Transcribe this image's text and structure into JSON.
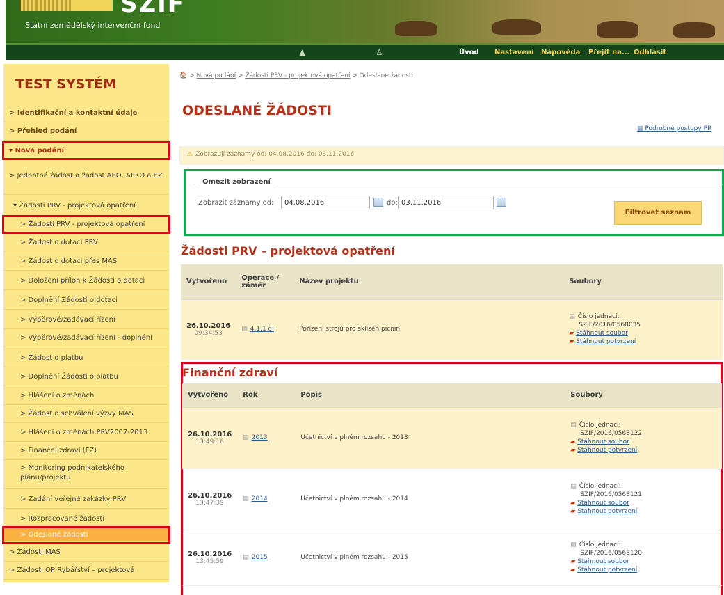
{
  "header": {
    "logo_text": "SZIF",
    "org_name": "Státní zemědělský intervenční fond",
    "nav": [
      "Úvod",
      "Nastavení",
      "Nápověda",
      "Přejít na...",
      "Odhlásit"
    ]
  },
  "sidebar": {
    "title": "TEST SYSTÉM",
    "items": [
      "> Identifikační a kontaktní údaje",
      "> Přehled podání",
      "▾ Nová podání",
      "> Jednotná žádost a žádost AEO, AEKO a EZ",
      "▾ Žádosti PRV - projektová opatření",
      "> Žádosti PRV - projektová opatření",
      "> Žádost o dotaci PRV",
      "> Žádost o dotaci přes MAS",
      "> Doložení příloh k Žádosti o dotaci",
      "> Doplnění Žádosti o dotaci",
      "> Výběrové/zadávací řízení",
      "> Výběrové/zadávací řízení - doplnění",
      "> Žádost o platbu",
      "> Doplnění Žádosti o platbu",
      "> Hlášení o změnách",
      "> Žádost o schválení výzvy MAS",
      "> Hlášení o změnách PRV2007-2013",
      "> Finanční zdraví (FZ)",
      "> Monitoring podnikatelského plánu/projektu",
      "> Zadání veřejné zakázky PRV",
      "> Rozpracované žádosti",
      "> Odeslané žádosti",
      "> Žádosti MAS",
      "> Žádosti OP Rybářství – projektová"
    ]
  },
  "main": {
    "breadcrumb": {
      "home": "🏠",
      "sep1": " > ",
      "b1": "Nová podání",
      "sep2": " > ",
      "b2": "Žádosti PRV - projektová opatření",
      "sep3": " > ",
      "b3": "Odeslané žádosti"
    },
    "title": "ODESLANÉ ŽÁDOSTI",
    "details_link": "Podrobné postupy PR",
    "notice": "Zobrazují záznamy od: 04.08.2016 do: 03.11.2016",
    "filter": {
      "legend": "Omezit zobrazení",
      "from_label": "Zobrazit záznamy od:",
      "from_value": "04.08.2016",
      "to_label": "do:",
      "to_value": "03.11.2016",
      "button": "Filtrovat seznam"
    },
    "prv": {
      "title": "Žádosti PRV – projektová opatření",
      "headers": [
        "Vytvořeno",
        "Operace / záměr",
        "Název projektu",
        "Soubory"
      ],
      "rows": [
        {
          "date": "26.10.2016",
          "time": "09:34:53",
          "op": "4.1.1 c)",
          "name": "Pořízení strojů pro sklizeň pícnin",
          "doc_label": "Číslo jednací:",
          "doc_no": "SZIF/2016/0568035",
          "f1": "Stáhnout soubor",
          "f2": "Stáhnout potvrzení"
        }
      ]
    },
    "fz": {
      "title": "Finanční zdraví",
      "headers": [
        "Vytvořeno",
        "Rok",
        "Popis",
        "Soubory"
      ],
      "rows": [
        {
          "date": "26.10.2016",
          "time": "13:49:16",
          "year": "2013",
          "desc": "Účetnictví v plném rozsahu - 2013",
          "doc_label": "Číslo jednací:",
          "doc_no": "SZIF/2016/0568122",
          "f1": "Stáhnout soubor",
          "f2": "Stáhnout potvrzení"
        },
        {
          "date": "26.10.2016",
          "time": "13:47:39",
          "year": "2014",
          "desc": "Účetnictví v plném rozsahu - 2014",
          "doc_label": "Číslo jednací:",
          "doc_no": "SZIF/2016/0568121",
          "f1": "Stáhnout soubor",
          "f2": "Stáhnout potvrzení"
        },
        {
          "date": "26.10.2016",
          "time": "13:45:59",
          "year": "2015",
          "desc": "Účetnictví v plném rozsahu - 2015",
          "doc_label": "Číslo jednací:",
          "doc_no": "SZIF/2016/0568120",
          "f1": "Stáhnout soubor",
          "f2": "Stáhnout potvrzení"
        }
      ]
    }
  },
  "colors": {
    "brand_green": "#15451a",
    "title_red": "#b4321a",
    "sidebar_yellow": "#fbe789",
    "highlight_red": "#e0001a",
    "highlight_green": "#11aa44"
  }
}
